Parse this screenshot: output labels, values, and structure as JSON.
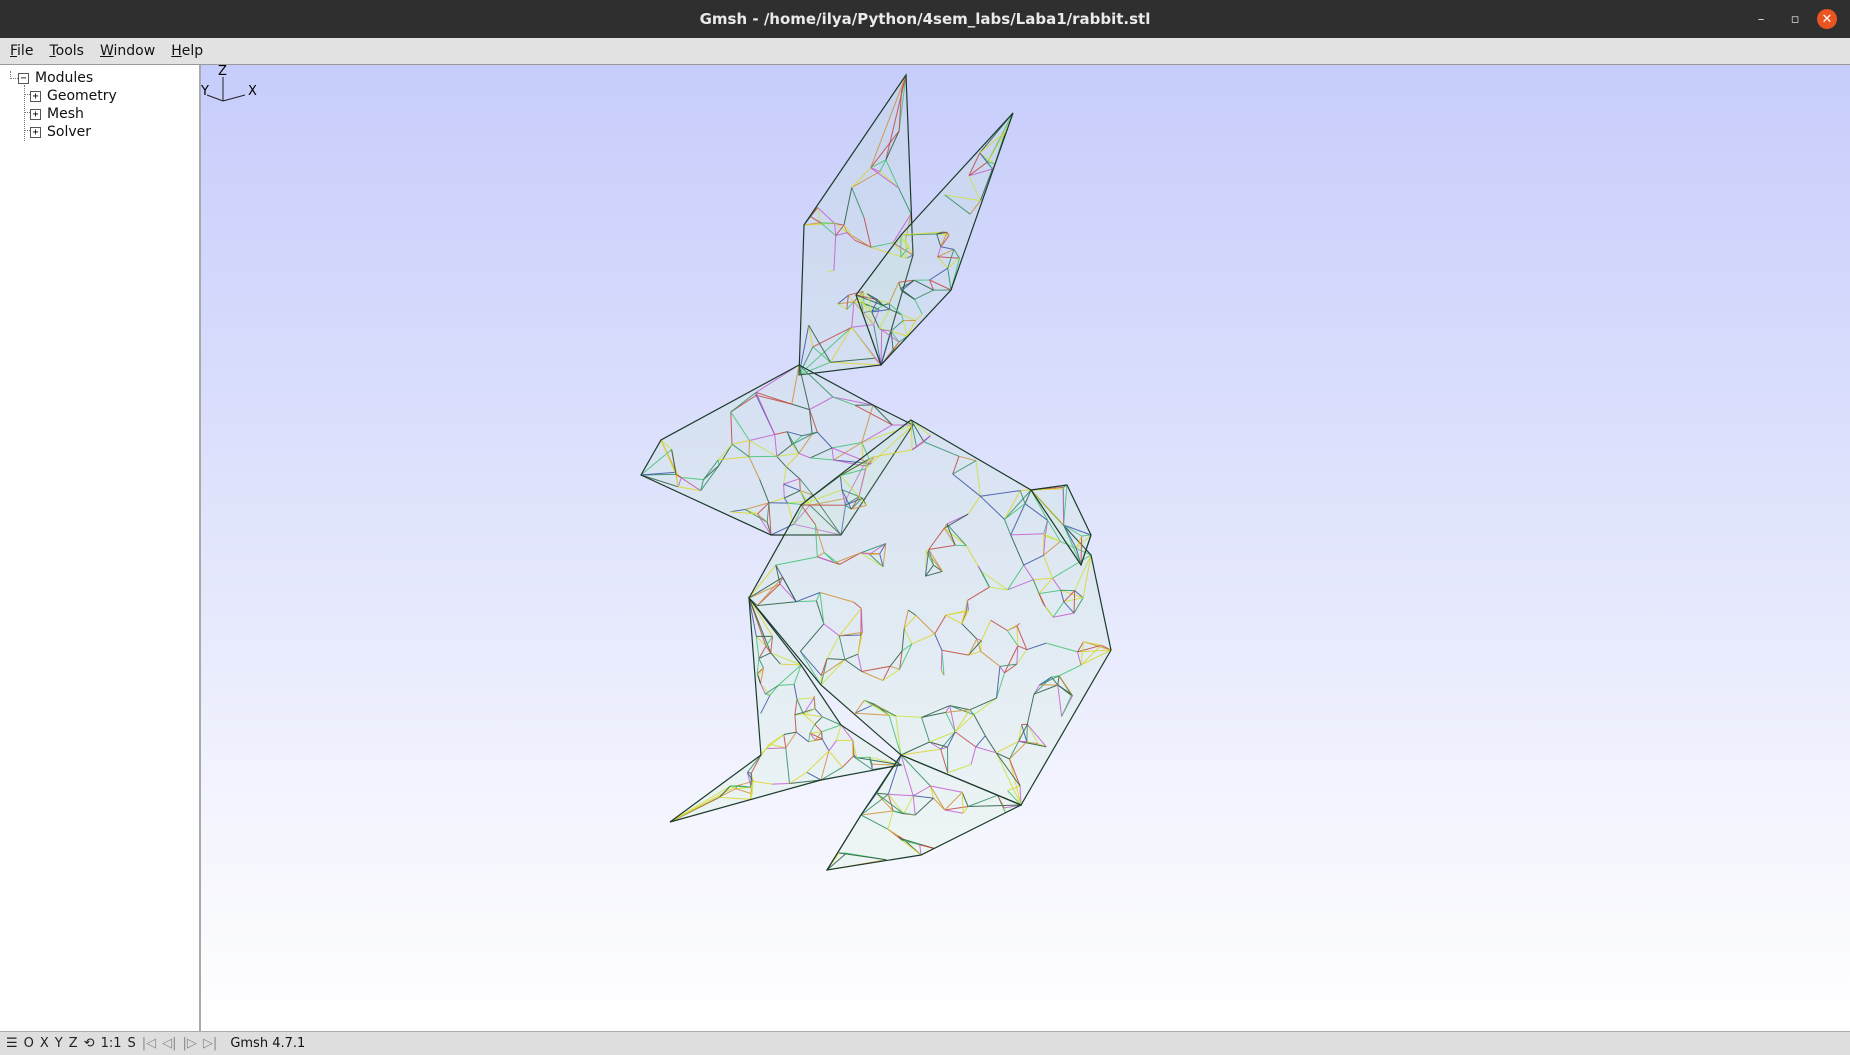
{
  "window": {
    "title": "Gmsh - /home/ilya/Python/4sem_labs/Laba1/rabbit.stl",
    "controls": {
      "minimize": "–",
      "maximize": "▫",
      "close": "✕"
    }
  },
  "menubar": {
    "items": [
      {
        "label": "File",
        "underline": "F",
        "rest": "ile"
      },
      {
        "label": "Tools",
        "underline": "T",
        "rest": "ools"
      },
      {
        "label": "Window",
        "underline": "W",
        "rest": "indow"
      },
      {
        "label": "Help",
        "underline": "H",
        "rest": "elp"
      }
    ]
  },
  "tree": {
    "root": {
      "label": "Modules",
      "expander": "−"
    },
    "children": [
      {
        "label": "Geometry",
        "expander": "+"
      },
      {
        "label": "Mesh",
        "expander": "+"
      },
      {
        "label": "Solver",
        "expander": "+"
      }
    ]
  },
  "settings_button": {
    "icon": "gear-icon",
    "menu_icon": "triangle-down-icon"
  },
  "graphics": {
    "background_top": "#c7cdfb",
    "background_bottom": "#ffffff",
    "mesh_colors": [
      "#0a7a4a",
      "#22b85c",
      "#c9e21c",
      "#e0d000",
      "#1a2fa0",
      "#c43ad2",
      "#d07a10",
      "#c02020",
      "#003a20"
    ],
    "axes": {
      "z": "Z",
      "y": "Y",
      "x": "X"
    }
  },
  "statusbar": {
    "buttons": [
      {
        "name": "menu-toggle",
        "text": "☰"
      },
      {
        "name": "view-o",
        "text": "O"
      },
      {
        "name": "view-x",
        "text": "X"
      },
      {
        "name": "view-y",
        "text": "Y"
      },
      {
        "name": "view-z",
        "text": "Z"
      },
      {
        "name": "rotate",
        "text": "⟲"
      },
      {
        "name": "scale-1-1",
        "text": "1:1"
      },
      {
        "name": "select",
        "text": "S"
      }
    ],
    "playback": [
      "|◁",
      "◁|",
      "|▷",
      "▷|"
    ],
    "status_text": "Gmsh 4.7.1"
  }
}
